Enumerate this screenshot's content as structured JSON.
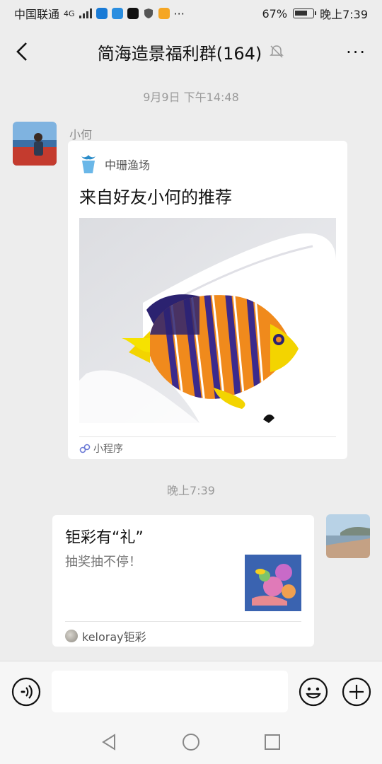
{
  "status_bar": {
    "carrier": "中国联通",
    "network": "4G",
    "battery_pct": "67%",
    "time": "晚上7:39",
    "more": "···"
  },
  "header": {
    "title": "简海造景福利群(164)",
    "more": "···"
  },
  "messages": [
    {
      "timestamp": "9月9日 下午14:48",
      "sender": "小何",
      "card": {
        "source": "中珊渔场",
        "title": "来自好友小何的推荐",
        "footer": "小程序"
      }
    },
    {
      "timestamp": "晚上7:39",
      "card": {
        "title": "钜彩有“礼”",
        "description": "抽奖抽不停！",
        "source": "keloray钜彩"
      }
    }
  ],
  "input": {
    "placeholder": ""
  },
  "colors": {
    "background": "#ededed",
    "card": "#ffffff",
    "muted_text": "#9a9a9a"
  }
}
